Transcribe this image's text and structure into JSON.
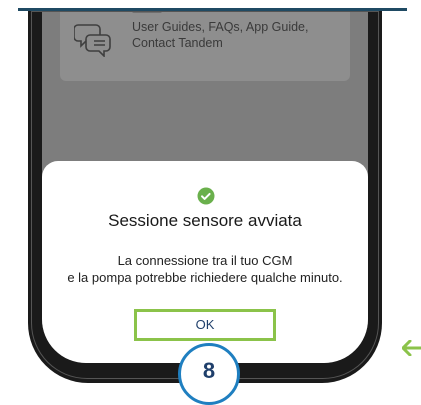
{
  "help_card": {
    "line1": "User Guides, FAQs, App Guide,",
    "line2": "Contact Tandem",
    "icon": "chat-bubbles-icon"
  },
  "dialog": {
    "icon": "check-circle-icon",
    "title": "Sessione sensore avviata",
    "message_line1": "La connessione tra il tuo CGM",
    "message_line2": "e la pompa potrebbe richiedere qualche minuto.",
    "ok_label": "OK"
  },
  "step": {
    "number": "8"
  },
  "colors": {
    "accent_green": "#8bc34a",
    "check_green": "#6ab04c",
    "badge_blue": "#1f7fc0",
    "rule_navy": "#1f4a63"
  },
  "annotation_arrow": {
    "icon": "arrow-left-icon"
  }
}
